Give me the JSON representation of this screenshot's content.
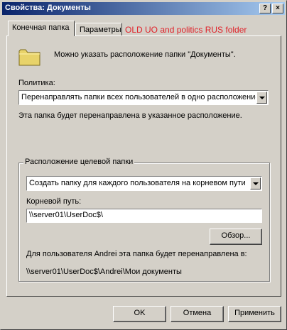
{
  "window": {
    "title": "Свойства: Документы",
    "help_label": "?",
    "close_label": "×"
  },
  "tabs": [
    {
      "label": "Конечная папка"
    },
    {
      "label": "Параметры"
    }
  ],
  "overlay_note": "OLD UO  and politics RUS folder",
  "target": {
    "folder_icon": "folder-icon",
    "description": "Можно указать расположение папки \"Документы\".",
    "policy_label": "Политика:",
    "policy_value": "Перенаправлять папки всех пользователей в одно расположение",
    "redirect_note": "Эта папка будет перенаправлена в указанное расположение.",
    "location_group_title": "Расположение целевой папки",
    "location_value": "Создать папку для каждого пользователя на корневом пути",
    "root_label": "Корневой путь:",
    "root_value": "\\\\server01\\UserDoc$\\",
    "browse_label": "Обзор...",
    "example_note": "Для пользователя Andrei эта папка будет перенаправлена в:",
    "example_path": "\\\\server01\\UserDoc$\\Andrei\\Мои документы"
  },
  "footer": {
    "ok_label": "OK",
    "cancel_label": "Отмена",
    "apply_label": "Применить"
  },
  "colors": {
    "titlebar_start": "#0a246a",
    "titlebar_end": "#a6caf0",
    "overlay_text": "#e0222a",
    "face": "#d4d0c8"
  }
}
